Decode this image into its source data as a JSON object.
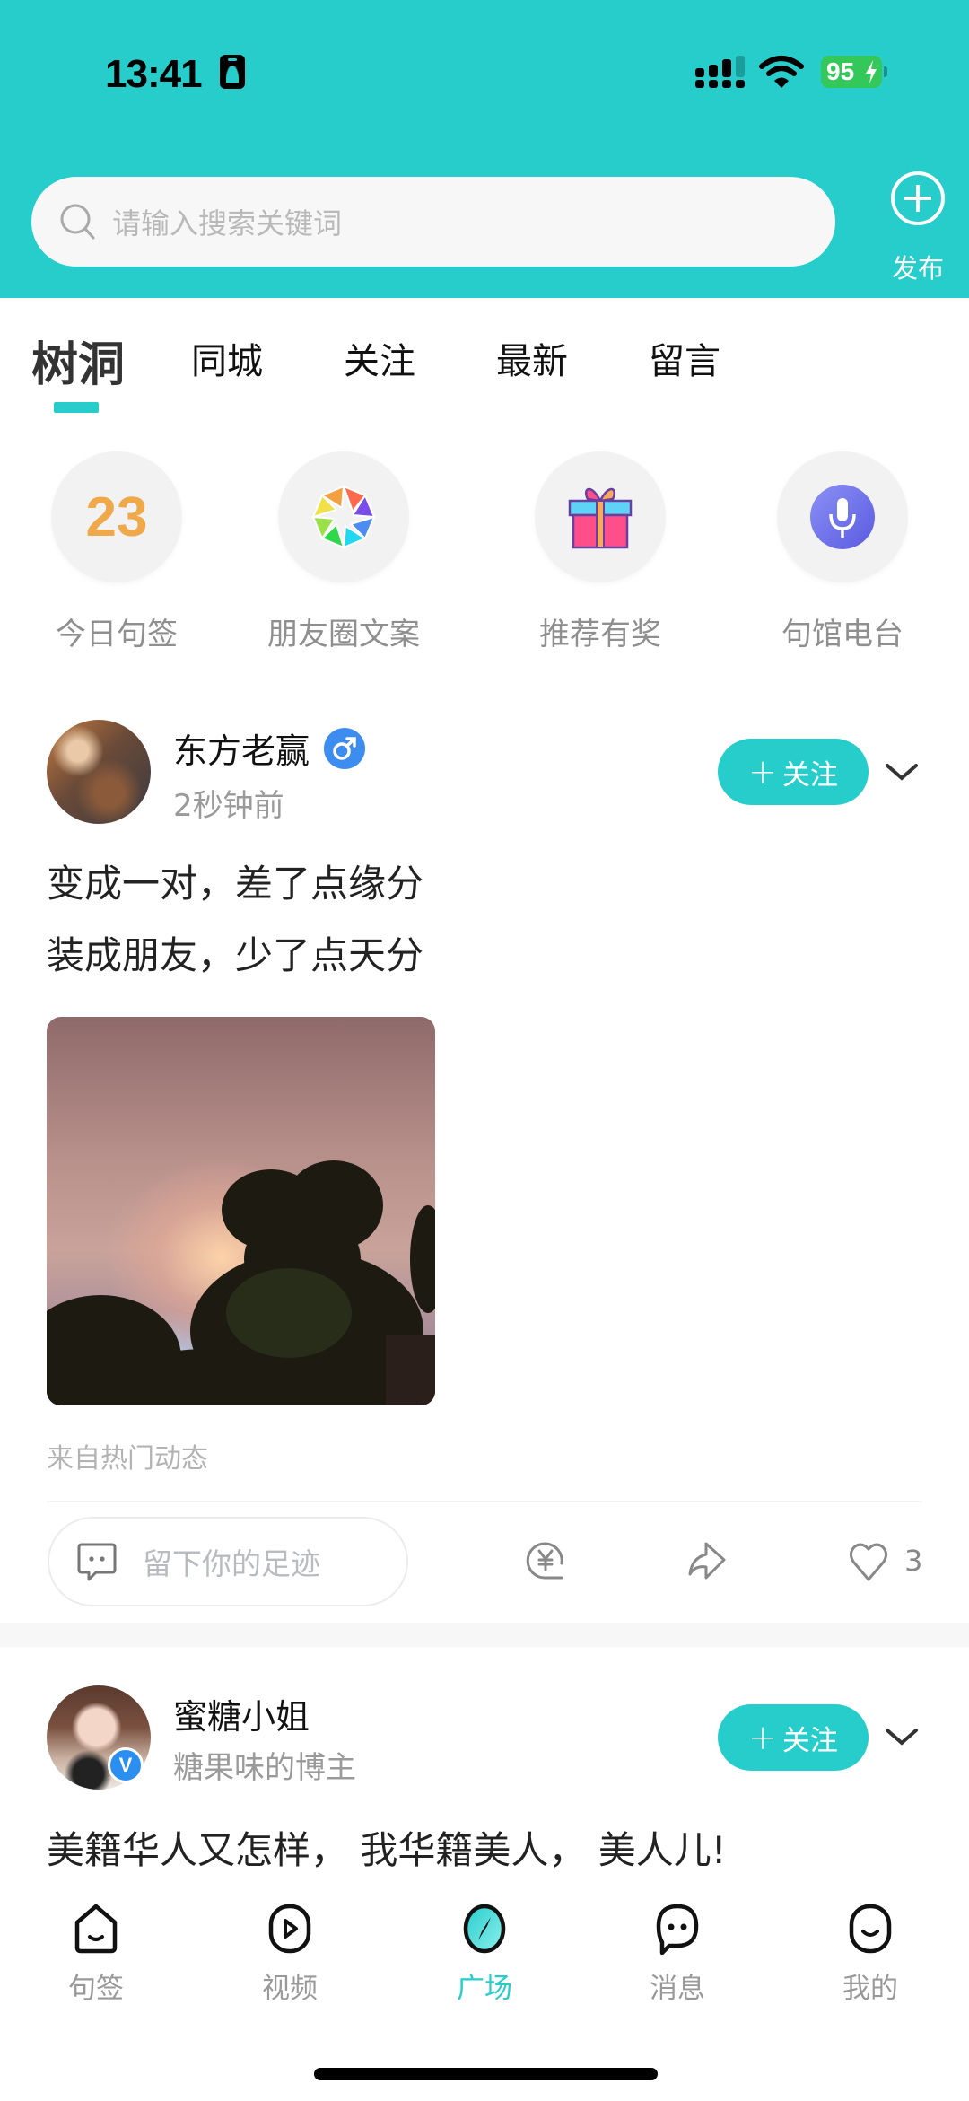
{
  "status_bar": {
    "time": "13:41",
    "battery_level": "95",
    "charging": true
  },
  "header": {
    "search_placeholder": "请输入搜索关键词",
    "publish_label": "发布",
    "accent_color": "#27cdcb"
  },
  "tabs": [
    {
      "label": "树洞",
      "active": true
    },
    {
      "label": "同城",
      "active": false
    },
    {
      "label": "关注",
      "active": false
    },
    {
      "label": "最新",
      "active": false
    },
    {
      "label": "留言",
      "active": false
    }
  ],
  "quick_links": [
    {
      "label": "今日句签",
      "icon": "calendar-day-icon",
      "value": "23"
    },
    {
      "label": "朋友圈文案",
      "icon": "aperture-icon"
    },
    {
      "label": "推荐有奖",
      "icon": "gift-icon"
    },
    {
      "label": "句馆电台",
      "icon": "microphone-icon"
    }
  ],
  "posts": [
    {
      "author": "东方老赢",
      "gender": "male",
      "subtitle": "2秒钟前",
      "follow_label": "关注",
      "lines": [
        "变成一对，差了点缘分",
        "装成朋友，少了点天分"
      ],
      "source": "来自热门动态",
      "comment_placeholder": "留下你的足迹",
      "likes": "3"
    },
    {
      "author": "蜜糖小姐",
      "verified": true,
      "verified_label": "V",
      "subtitle": "糖果味的博主",
      "follow_label": "关注",
      "lines": [
        "美籍华人又怎样， 我华籍美人， 美人儿!"
      ]
    }
  ],
  "bottom_nav": [
    {
      "label": "句签",
      "icon": "home-icon",
      "active": false
    },
    {
      "label": "视频",
      "icon": "video-play-icon",
      "active": false
    },
    {
      "label": "广场",
      "icon": "compass-icon",
      "active": true
    },
    {
      "label": "消息",
      "icon": "message-icon",
      "active": false
    },
    {
      "label": "我的",
      "icon": "profile-icon",
      "active": false
    }
  ]
}
